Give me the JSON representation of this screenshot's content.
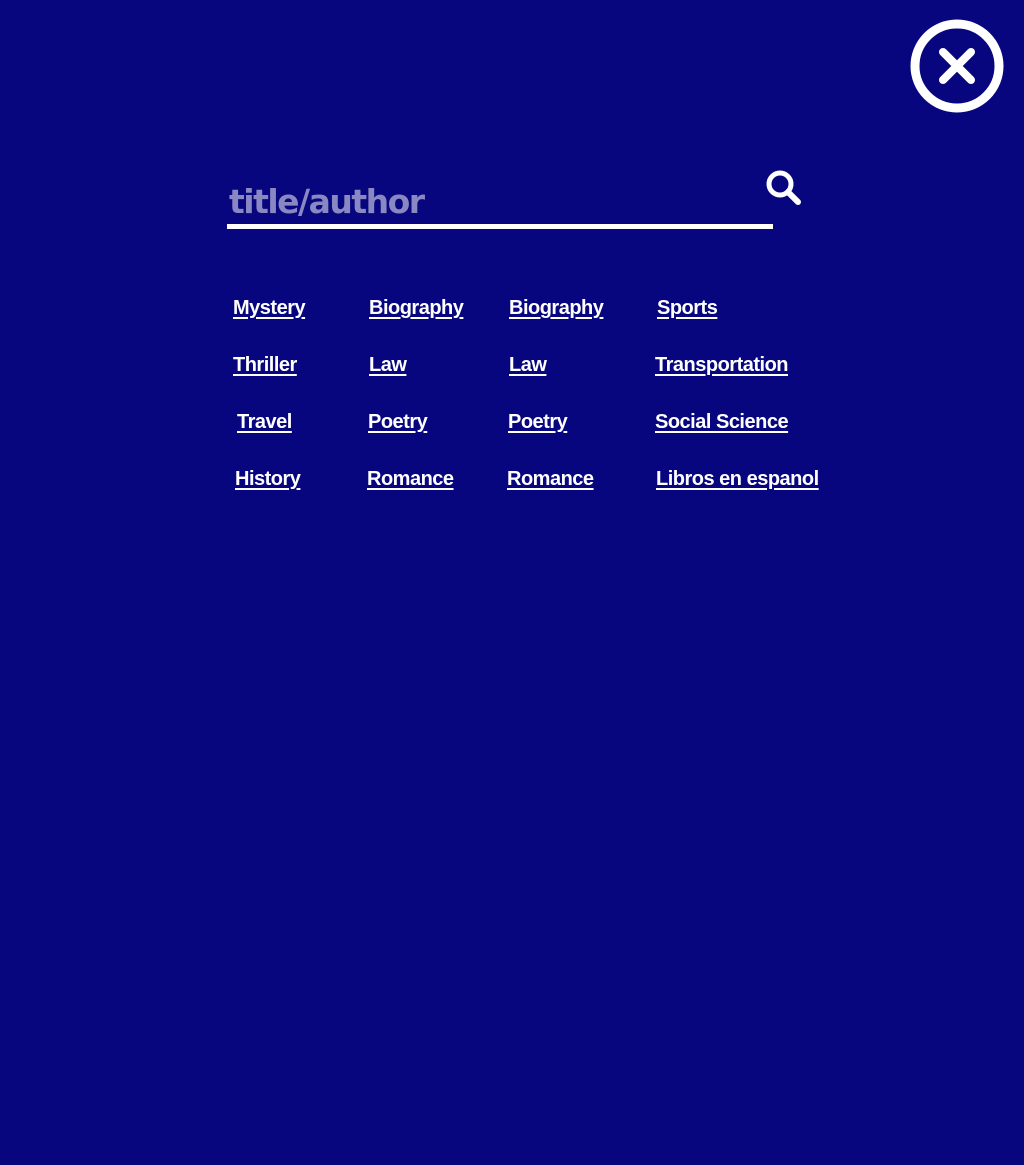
{
  "close": {
    "icon": "close-circle-icon"
  },
  "search": {
    "placeholder": "title/author",
    "value": "",
    "icon": "search-icon"
  },
  "genres": {
    "columns": [
      [
        "Mystery",
        "Thriller",
        "Travel",
        "History"
      ],
      [
        "Biography",
        "Law",
        "Poetry",
        "Romance"
      ],
      [
        "Biography",
        "Law",
        "Poetry",
        "Romance"
      ],
      [
        "Sports",
        "Transportation",
        "Social Science",
        "Libros en espanol"
      ]
    ]
  },
  "colors": {
    "background": "#07067e",
    "foreground": "#ffffff",
    "placeholder": "#8a88c2"
  }
}
